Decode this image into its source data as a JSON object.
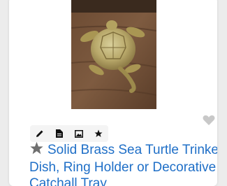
{
  "listing": {
    "title": "Solid Brass Sea Turtle Trinket Dish, Ring Holder or Decorative Catchall Tray"
  },
  "toolbar": {
    "tools": [
      {
        "icon": "pencil-icon"
      },
      {
        "icon": "document-icon"
      },
      {
        "icon": "image-icon"
      },
      {
        "icon": "star-icon"
      }
    ]
  },
  "favorite": {
    "icon": "heart-icon",
    "color": "#c8c8c8"
  },
  "title_star": {
    "icon": "star-icon",
    "color": "#6f6f6f"
  },
  "colors": {
    "title_link": "#1f6fc7",
    "card_background": "#ffffff",
    "page_background": "#ececec"
  }
}
